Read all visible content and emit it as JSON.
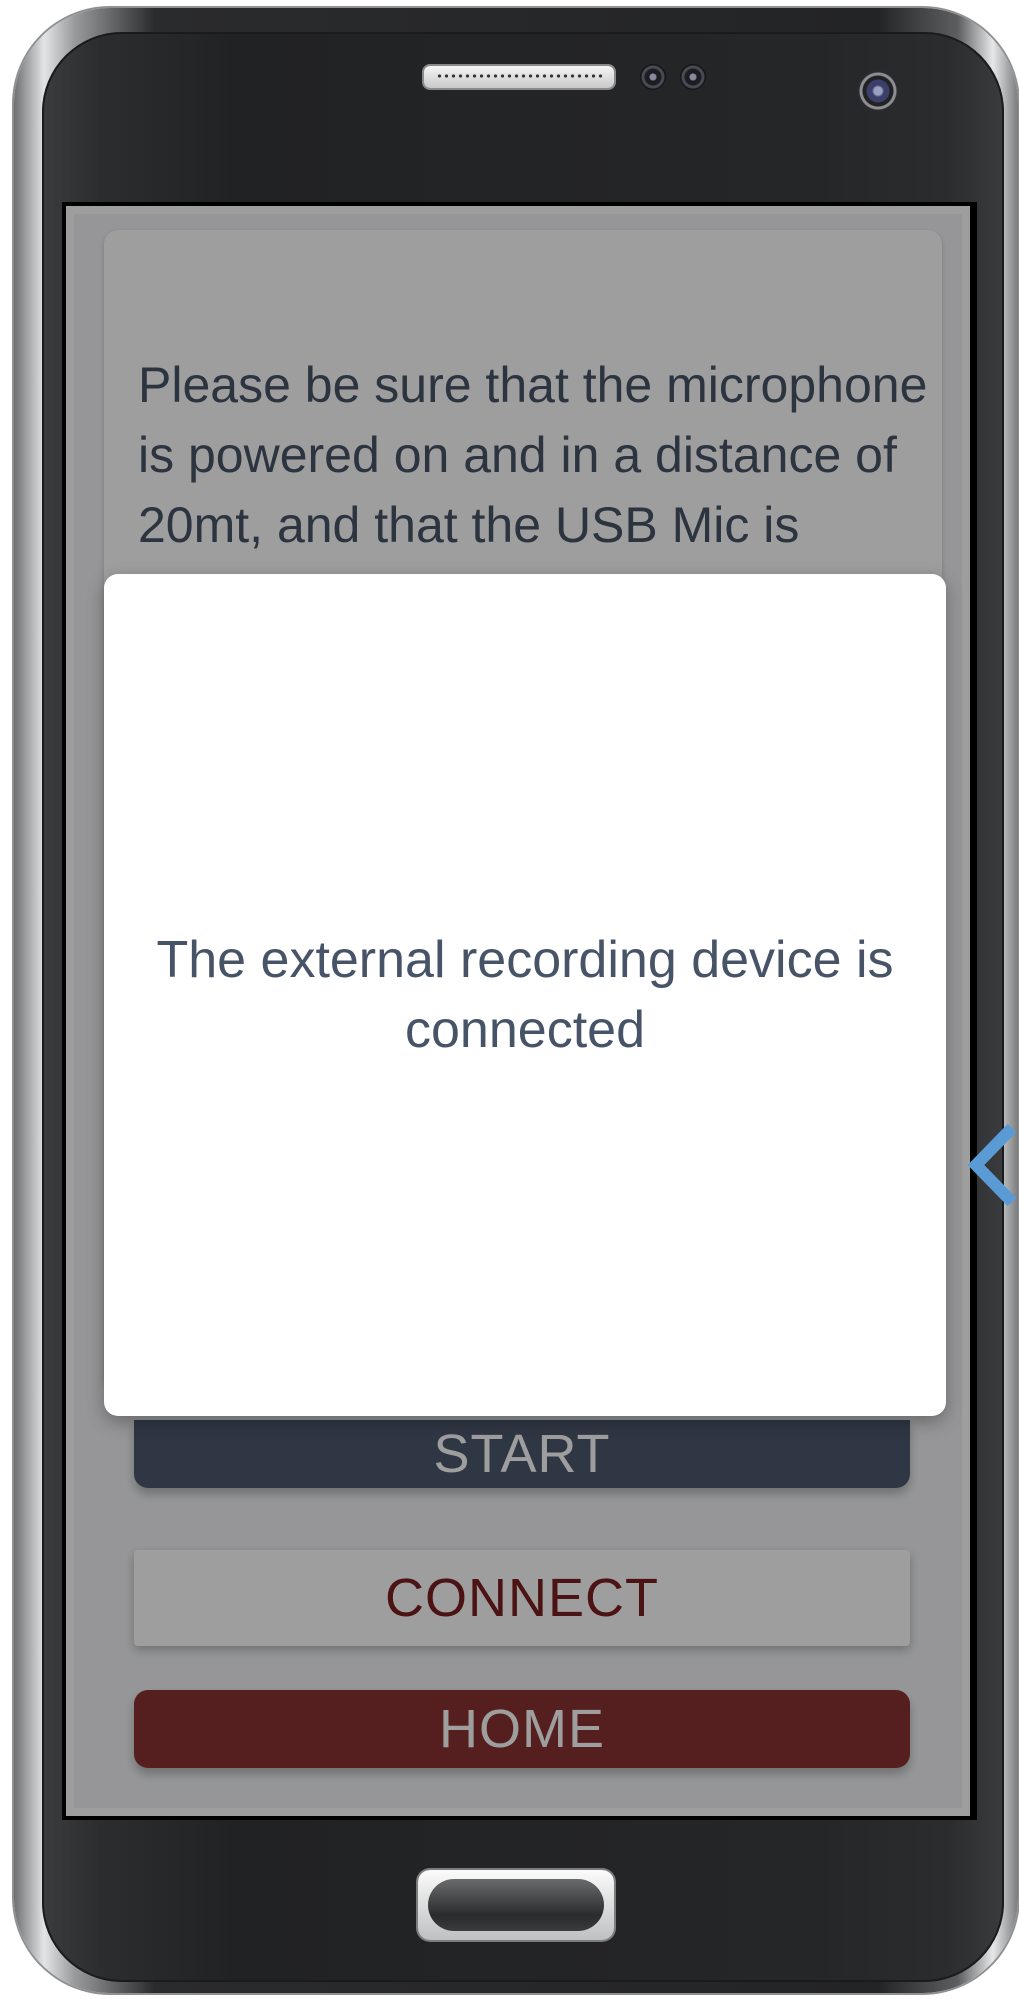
{
  "app": {
    "instructions_text": "Please be sure that the microphone is powered on and in a distance of 20mt, and that the USB Mic is connected to",
    "buttons": {
      "start_label": "START",
      "connect_label": "CONNECT",
      "home_label": "HOME"
    },
    "dialog": {
      "message": "The external recording device is connected"
    }
  },
  "colors": {
    "text": "#475467",
    "start_button": "#4e5a6e",
    "connect_text": "#7a1f1f",
    "home_button": "#8c3232",
    "arrow": "#5b9bd5"
  },
  "icons": {
    "speaker": "speaker-grille-icon",
    "camera": "front-camera-icon",
    "sensors": "proximity-sensor-icon",
    "home_key": "home-key-icon",
    "arrow": "arrow-left-icon"
  }
}
